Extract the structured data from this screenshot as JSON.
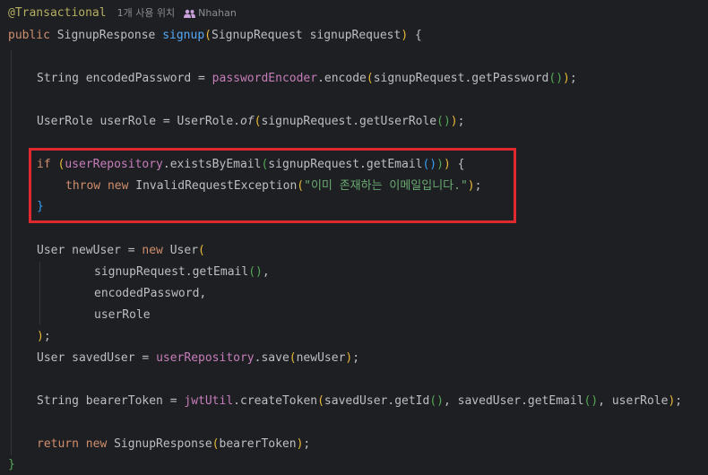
{
  "hint": {
    "annotation": "@Transactional",
    "usages": "1개 사용 위치",
    "author": "Nhahan",
    "author_icon": "people-icon"
  },
  "code": {
    "l1_kw": "public ",
    "l1_type": "SignupResponse ",
    "l1_fn": "signup",
    "l1_open": "(",
    "l1_params": "SignupRequest signupRequest",
    "l1_close": ")",
    "l1_brace": " {",
    "l2_a": "String encodedPassword = ",
    "l2_field": "passwordEncoder",
    "l2_b": ".encode",
    "l2_p1": "(",
    "l2_c": "signupRequest.getPassword",
    "l2_p2": "()",
    "l2_p3": ")",
    "l2_end": ";",
    "l3_a": "UserRole userRole = UserRole.",
    "l3_static": "of",
    "l3_p1": "(",
    "l3_b": "signupRequest.getUserRole",
    "l3_p2": "()",
    "l3_p3": ")",
    "l3_end": ";",
    "l4_kw": "if ",
    "l4_p1": "(",
    "l4_field": "userRepository",
    "l4_a": ".existsByEmail",
    "l4_p2": "(",
    "l4_b": "signupRequest.getEmail",
    "l4_p3": "()",
    "l4_p4": ")",
    "l4_p5": ")",
    "l4_brace": " {",
    "l5_kw": "throw new ",
    "l5_a": "InvalidRequestException",
    "l5_p1": "(",
    "l5_str": "\"이미 존재하는 이메일입니다.\"",
    "l5_p2": ")",
    "l5_end": ";",
    "l6": "}",
    "l7_a": "User newUser = ",
    "l7_kw": "new ",
    "l7_b": "User",
    "l7_p": "(",
    "l8": "signupRequest.getEmail",
    "l8_p": "()",
    "l8_end": ",",
    "l9": "encodedPassword,",
    "l10": "userRole",
    "l11_p": ")",
    "l11_end": ";",
    "l12_a": "User savedUser = ",
    "l12_field": "userRepository",
    "l12_b": ".save",
    "l12_p1": "(",
    "l12_c": "newUser",
    "l12_p2": ")",
    "l12_end": ";",
    "l13_a": "String bearerToken = ",
    "l13_field": "jwtUtil",
    "l13_b": ".createToken",
    "l13_p1": "(",
    "l13_c": "savedUser.getId",
    "l13_p2": "()",
    "l13_d": ", savedUser.getEmail",
    "l13_p3": "()",
    "l13_e": ", userRole",
    "l13_p4": ")",
    "l13_end": ";",
    "l14_kw": "return new ",
    "l14_a": "SignupResponse",
    "l14_p1": "(",
    "l14_b": "bearerToken",
    "l14_p2": ")",
    "l14_end": ";",
    "l15": "}"
  },
  "colors": {
    "background": "#1e1f22",
    "keyword": "#cf8e6d",
    "function": "#56a8f5",
    "field": "#c77dbb",
    "string": "#6aab73",
    "annotation": "#b3ae60",
    "highlight_border": "#e0282f"
  }
}
